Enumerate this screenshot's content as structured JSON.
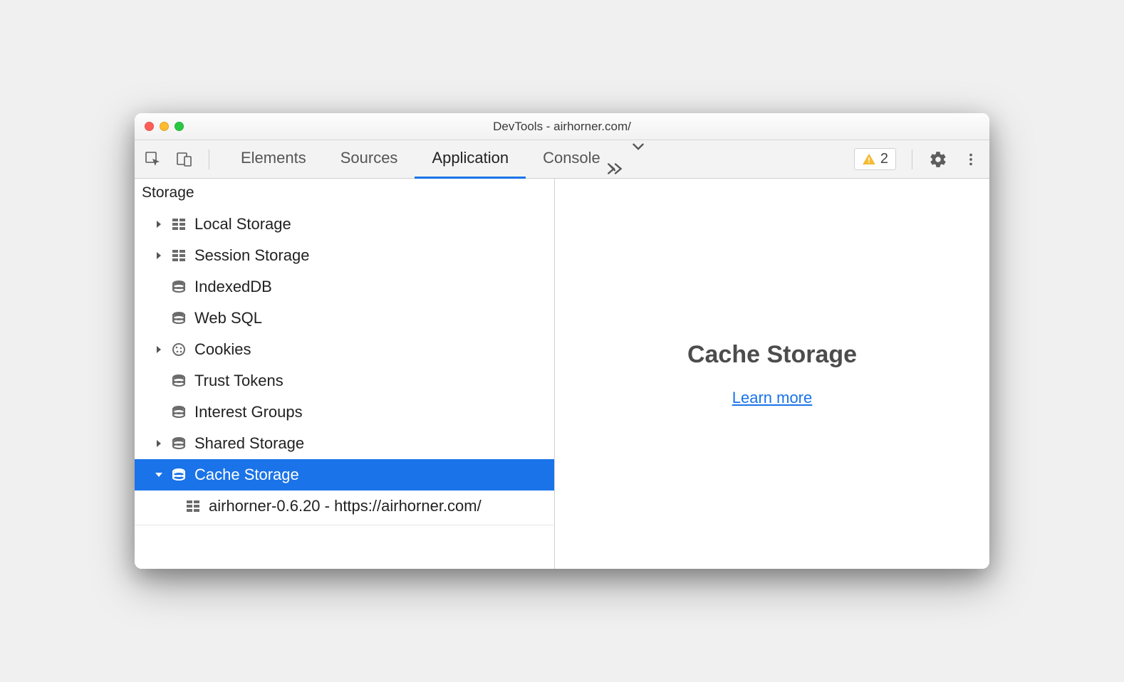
{
  "window": {
    "title": "DevTools - airhorner.com/"
  },
  "toolbar": {
    "tabs": {
      "elements": "Elements",
      "sources": "Sources",
      "application": "Application",
      "console": "Console"
    },
    "issues_count": "2"
  },
  "sidebar": {
    "header": "Storage",
    "items": {
      "local_storage": "Local Storage",
      "session_storage": "Session Storage",
      "indexeddb": "IndexedDB",
      "web_sql": "Web SQL",
      "cookies": "Cookies",
      "trust_tokens": "Trust Tokens",
      "interest_groups": "Interest Groups",
      "shared_storage": "Shared Storage",
      "cache_storage": "Cache Storage",
      "cache_entry": "airhorner-0.6.20 - https://airhorner.com/"
    }
  },
  "main": {
    "heading": "Cache Storage",
    "learn_more": "Learn more"
  }
}
